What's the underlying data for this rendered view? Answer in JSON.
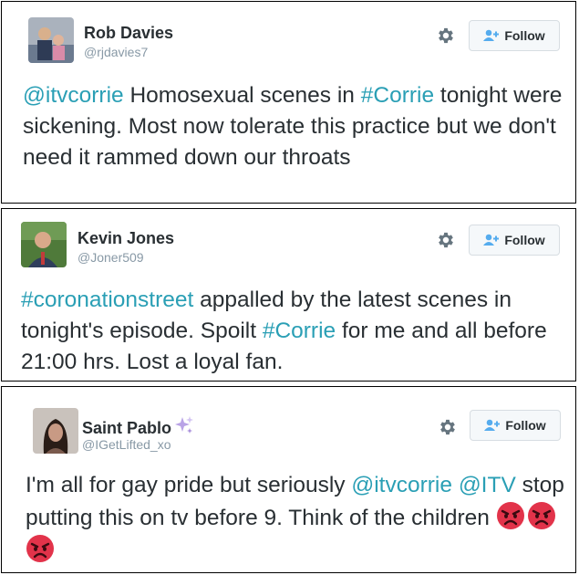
{
  "tweets": [
    {
      "name": "Rob Davies",
      "handle": "@rjdavies7",
      "follow_label": "Follow",
      "text": {
        "mention1": "@itvcorrie",
        "seg1": " Homosexual scenes in ",
        "hashtag1": "#Corrie",
        "seg2": " tonight were sickening. Most now tolerate this practice but we don't need it rammed down our throats"
      }
    },
    {
      "name": "Kevin Jones",
      "handle": "@Joner509",
      "follow_label": "Follow",
      "text": {
        "hashtag1": "#coronationstreet",
        "seg1": " appalled by the latest scenes in tonight's episode. Spoilt ",
        "hashtag2": "#Corrie",
        "seg2": " for me and all before 21:00 hrs. Lost a loyal fan."
      }
    },
    {
      "name": "Saint Pablo",
      "handle": "@IGetLifted_xo",
      "follow_label": "Follow",
      "name_icon": "sparkles-icon",
      "text": {
        "seg1": "I'm all for gay pride but seriously ",
        "mention1": "@itvcorrie",
        "mention2": "@ITV",
        "seg2": " stop putting this on tv before 9. Think of the children ",
        "emoji": [
          "angry-face-icon",
          "angry-face-icon",
          "angry-face-icon"
        ]
      }
    }
  ],
  "colors": {
    "link": "#2a9fb5",
    "text": "#292f33",
    "handle": "#8899a6",
    "button_bg": "#f5f8fa",
    "button_border": "#d7dde2",
    "icon_blue": "#55acee"
  }
}
